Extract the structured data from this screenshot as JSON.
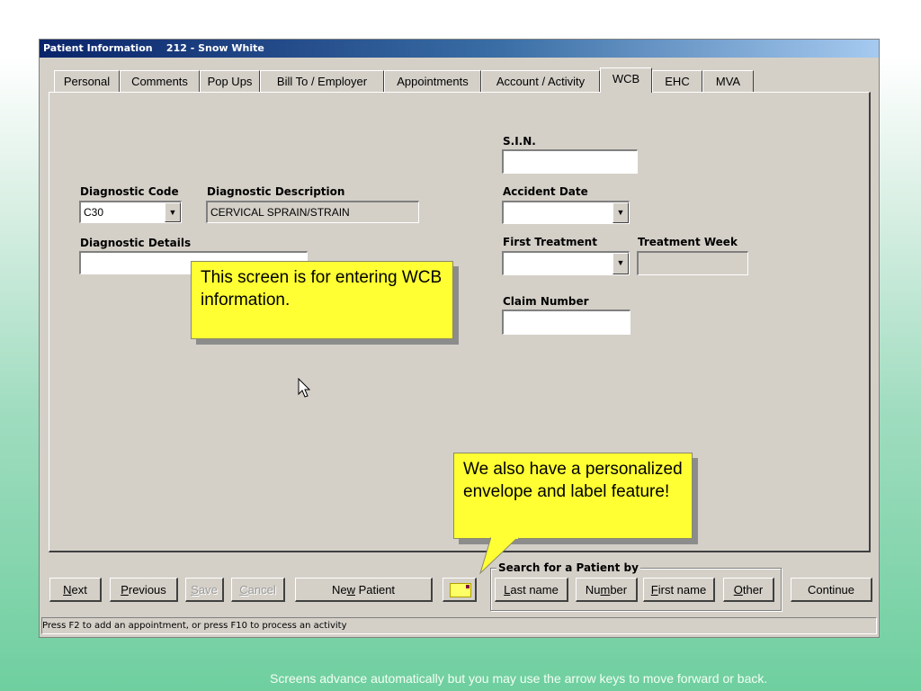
{
  "window": {
    "title": "Patient Information    212 - Snow White"
  },
  "tabs": [
    "Personal",
    "Comments",
    "Pop Ups",
    "Bill To / Employer",
    "Appointments",
    "Account / Activity",
    "WCB",
    "EHC",
    "MVA"
  ],
  "active_tab": "WCB",
  "form": {
    "diagnostic_code_label": "Diagnostic Code",
    "diagnostic_code_value": "C30",
    "diagnostic_description_label": "Diagnostic Description",
    "diagnostic_description_value": "CERVICAL SPRAIN/STRAIN",
    "diagnostic_details_label": "Diagnostic Details",
    "diagnostic_details_value": "",
    "sin_label": "S.I.N.",
    "sin_value": "",
    "accident_date_label": "Accident Date",
    "accident_date_value": "",
    "first_treatment_label": "First Treatment",
    "first_treatment_value": "",
    "treatment_week_label": "Treatment Week",
    "treatment_week_value": "",
    "claim_number_label": "Claim Number",
    "claim_number_value": ""
  },
  "buttons": {
    "next": {
      "mnemonic": "N",
      "rest": "ext"
    },
    "previous": {
      "mnemonic": "P",
      "rest": "revious"
    },
    "save": {
      "mnemonic": "S",
      "rest": "ave"
    },
    "cancel": {
      "mnemonic": "C",
      "rest": "ancel"
    },
    "new_patient": {
      "pre": "Ne",
      "mnemonic": "w",
      "post": " Patient"
    },
    "last_name": {
      "mnemonic": "L",
      "rest": "ast name"
    },
    "number": {
      "pre": "Nu",
      "mnemonic": "m",
      "post": "ber"
    },
    "first_name": {
      "mnemonic": "F",
      "rest": "irst name"
    },
    "other": {
      "mnemonic": "O",
      "rest": "ther"
    },
    "continue": "Continue"
  },
  "search_group_label": "Search for a Patient by",
  "status_text": "Press F2 to add an appointment,    or press F10 to process an activity",
  "callouts": {
    "wcb": "This screen is for entering WCB information.",
    "envelope": "We also have a personalized envelope and label feature!"
  },
  "footer_text": "Screens advance automatically but you may use the arrow keys to move forward or back.",
  "colors": {
    "callout": "#ffff33",
    "titlebar": "#0a246a",
    "window": "#d4d0c8"
  }
}
